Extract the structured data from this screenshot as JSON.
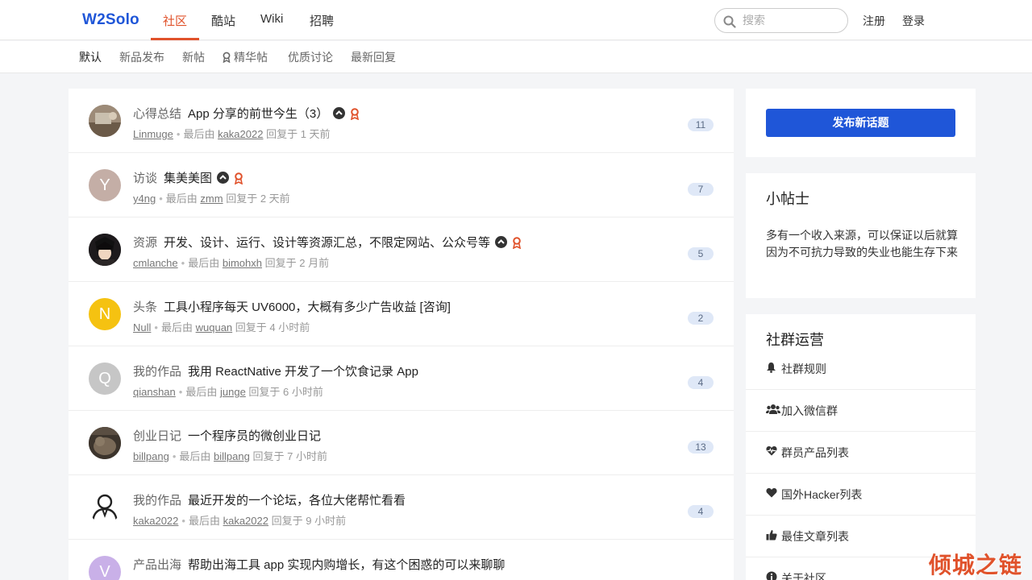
{
  "logo": {
    "text": "W2Solo"
  },
  "nav": {
    "items": [
      "社区",
      "酷站",
      "Wiki",
      "招聘"
    ]
  },
  "search": {
    "placeholder": "搜索"
  },
  "auth": {
    "register": "注册",
    "login": "登录"
  },
  "tabs": [
    "默认",
    "新品发布",
    "新帖",
    "精华帖",
    "优质讨论",
    "最新回复"
  ],
  "topics": [
    {
      "node": "心得总结",
      "title": "App 分享的前世今生（3）",
      "up": true,
      "excellent": true,
      "author": "Linmuge",
      "last_by": "kaka2022",
      "time": "回复于 1 天前",
      "replies": "11",
      "avatar_letter": "",
      "avatar_color": "#8a7a6a"
    },
    {
      "node": "访谈",
      "title": "集美美图",
      "up": true,
      "excellent": true,
      "author": "y4ng",
      "last_by": "zmm",
      "time": "回复于 2 天前",
      "replies": "7",
      "avatar_letter": "Y",
      "avatar_color": "#c4aea6"
    },
    {
      "node": "资源",
      "title": "开发、设计、运行、设计等资源汇总，不限定网站、公众号等",
      "up": true,
      "excellent": true,
      "author": "cmlanche",
      "last_by": "bimohxh",
      "time": "回复于 2 月前",
      "replies": "5",
      "avatar_letter": "",
      "avatar_color": "#2d2a2a"
    },
    {
      "node": "头条",
      "title": "工具小程序每天 UV6000，大概有多少广告收益 [咨询]",
      "up": false,
      "excellent": false,
      "author": "Null",
      "last_by": "wuquan",
      "time": "回复于 4 小时前",
      "replies": "2",
      "avatar_letter": "N",
      "avatar_color": "#f5c211"
    },
    {
      "node": "我的作品",
      "title": "我用 ReactNative 开发了一个饮食记录 App",
      "up": false,
      "excellent": false,
      "author": "qianshan",
      "last_by": "junge",
      "time": "回复于 6 小时前",
      "replies": "4",
      "avatar_letter": "Q",
      "avatar_color": "#c6c6c6"
    },
    {
      "node": "创业日记",
      "title": "一个程序员的微创业日记",
      "up": false,
      "excellent": false,
      "author": "billpang",
      "last_by": "billpang",
      "time": "回复于 7 小时前",
      "replies": "13",
      "avatar_letter": "",
      "avatar_color": "#4a4038"
    },
    {
      "node": "我的作品",
      "title": "最近开发的一个论坛，各位大佬帮忙看看",
      "up": false,
      "excellent": false,
      "author": "kaka2022",
      "last_by": "kaka2022",
      "time": "回复于 9 小时前",
      "replies": "4",
      "avatar_letter": "",
      "avatar_color": "#ffffff"
    },
    {
      "node": "产品出海",
      "title": "帮助出海工具 app 实现内购增长，有这个困惑的可以来聊聊",
      "up": false,
      "excellent": false,
      "author": "",
      "last_by": "",
      "time": "",
      "replies": "",
      "avatar_letter": "V",
      "avatar_color": "#c9b0e8"
    }
  ],
  "meta_labels": {
    "last_by": "最后由"
  },
  "sidebar": {
    "post_button": "发布新话题",
    "tips_title": "小帖士",
    "tips_text": "多有一个收入来源，可以保证以后就算因为不可抗力导致的失业也能生存下来",
    "ops_title": "社群运营",
    "ops_items": [
      {
        "label": "社群规则",
        "icon": "bell-icon"
      },
      {
        "label": "加入微信群",
        "icon": "users-icon"
      },
      {
        "label": "群员产品列表",
        "icon": "heartbeat-icon"
      },
      {
        "label": "国外Hacker列表",
        "icon": "heart-icon"
      },
      {
        "label": "最佳文章列表",
        "icon": "thumbs-up-icon"
      },
      {
        "label": "关于社区",
        "icon": "info-icon"
      }
    ]
  },
  "watermark": "倾城之链",
  "colors": {
    "brand": "#1f56d8",
    "accent": "#e0522b"
  }
}
